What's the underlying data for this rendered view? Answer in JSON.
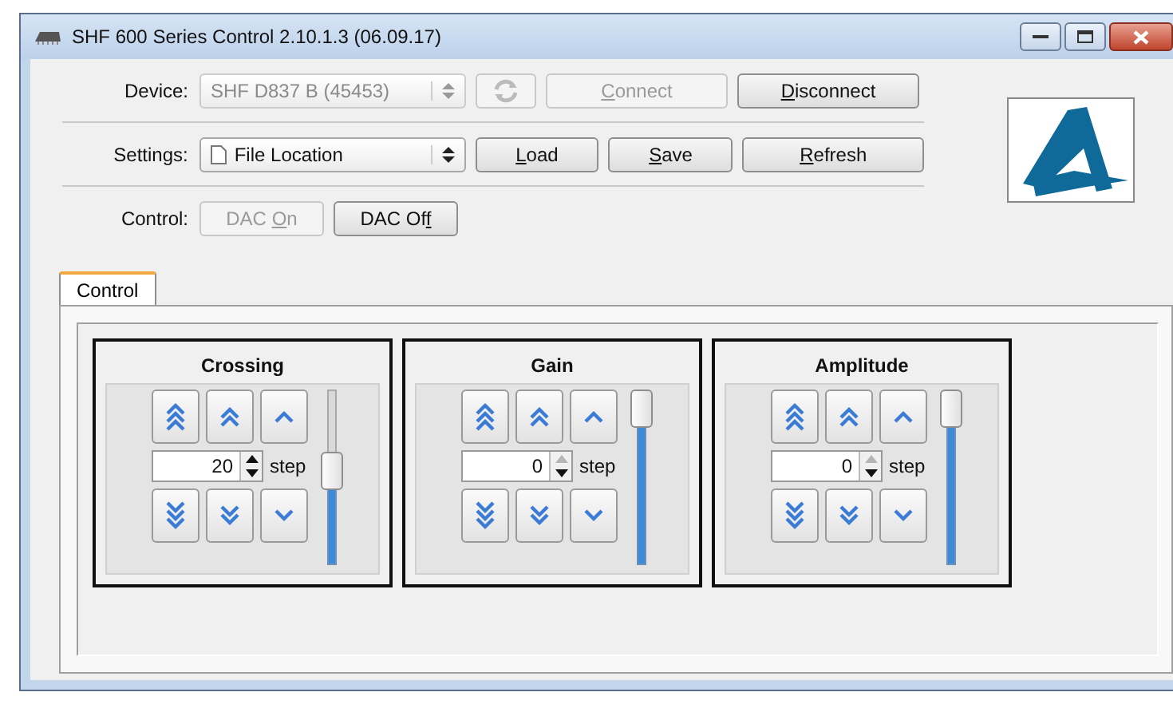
{
  "window": {
    "title": "SHF 600 Series Control 2.10.1.3 (06.09.17)"
  },
  "rows": [
    {
      "label": "Device:",
      "combo": {
        "kind": "device",
        "value": "SHF D837 B (45453)",
        "disabled": true
      },
      "buttons": [
        {
          "kind": "icon",
          "disabled": true
        },
        {
          "kind": "wide",
          "key": "C",
          "after": "onnect",
          "disabled": true
        },
        {
          "kind": "wide",
          "key": "D",
          "after": "isconnect",
          "disabled": false
        }
      ]
    },
    {
      "label": "Settings:",
      "combo": {
        "kind": "file",
        "value": "File Location",
        "disabled": false
      },
      "buttons": [
        {
          "kind": "narrow",
          "key": "L",
          "after": "oad",
          "disabled": false
        },
        {
          "kind": "narrow",
          "key": "S",
          "after": "ave",
          "disabled": false
        },
        {
          "kind": "wide",
          "key": "R",
          "after": "efresh",
          "disabled": false
        }
      ]
    },
    {
      "label": "Control:",
      "buttons": [
        {
          "kind": "narrow",
          "before": "DAC ",
          "key": "O",
          "after": "n",
          "disabled": true
        },
        {
          "kind": "narrow",
          "before": "DAC Of",
          "key": "f",
          "disabled": false
        }
      ]
    }
  ],
  "tabs": [
    {
      "label": "Control",
      "selected": true
    }
  ],
  "panels": [
    {
      "title": "Crossing",
      "value": "20",
      "up_disabled": false,
      "step_label": "step",
      "level": 0.55
    },
    {
      "title": "Gain",
      "value": "0",
      "up_disabled": true,
      "step_label": "step",
      "level": 1
    },
    {
      "title": "Amplitude",
      "value": "0",
      "up_disabled": true,
      "step_label": "step",
      "level": 1
    }
  ]
}
